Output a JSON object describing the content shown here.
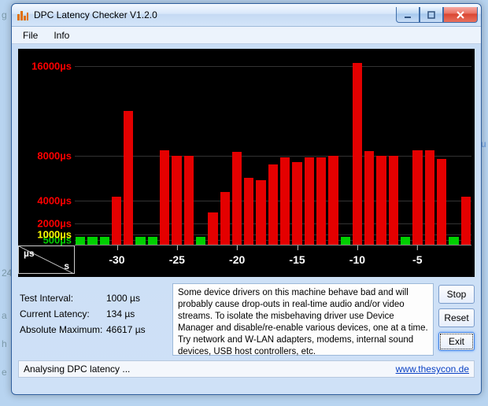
{
  "window": {
    "title": "DPC Latency Checker V1.2.0"
  },
  "menu": {
    "file": "File",
    "info": "Info"
  },
  "chart_data": {
    "type": "bar",
    "title": "",
    "xlabel": "s",
    "ylabel": "µs",
    "ylim": [
      0,
      17000
    ],
    "y_ticks": [
      {
        "v": 500,
        "label": "500µs",
        "color": "#00d000"
      },
      {
        "v": 1000,
        "label": "1000µs",
        "color": "#ffff00"
      },
      {
        "v": 2000,
        "label": "2000µs",
        "color": "#ff0000"
      },
      {
        "v": 4000,
        "label": "4000µs",
        "color": "#ff0000"
      },
      {
        "v": 8000,
        "label": "8000µs",
        "color": "#ff0000"
      },
      {
        "v": 16000,
        "label": "16000µs",
        "color": "#ff0000"
      }
    ],
    "x_ticks": [
      -30,
      -25,
      -20,
      -15,
      -10,
      -5
    ],
    "categories": [
      -33,
      -32,
      -31,
      -30,
      -29,
      -28,
      -27,
      -26,
      -25,
      -24,
      -23,
      -22,
      -21,
      -20,
      -19,
      -18,
      -17,
      -16,
      -15,
      -14,
      -13,
      -12,
      -11,
      -10,
      -9,
      -8,
      -7,
      -6,
      -5,
      -4,
      -3,
      -2,
      -1
    ],
    "series": [
      {
        "name": "green",
        "color": "#00d000",
        "values": [
          700,
          700,
          700,
          4300,
          12000,
          700,
          700,
          8500,
          8000,
          8000,
          700,
          2900,
          4700,
          8300,
          6000,
          5800,
          7200,
          7800,
          7400,
          7800,
          7800,
          8000,
          700,
          16300,
          8400,
          8000,
          8000,
          700,
          8500,
          8500,
          7700,
          700,
          4300
        ]
      },
      {
        "name": "red",
        "color": "#e40000",
        "values": [
          0,
          0,
          0,
          4300,
          12000,
          0,
          0,
          8500,
          8000,
          8000,
          0,
          2900,
          4700,
          8300,
          6000,
          5800,
          7200,
          7800,
          7400,
          7800,
          7800,
          8000,
          0,
          16300,
          8400,
          8000,
          8000,
          0,
          8500,
          8500,
          7700,
          0,
          4300
        ]
      }
    ]
  },
  "stats": {
    "test_interval_label": "Test Interval:",
    "test_interval_value": "1000 µs",
    "current_latency_label": "Current Latency:",
    "current_latency_value": "134 µs",
    "absolute_max_label": "Absolute Maximum:",
    "absolute_max_value": "46617 µs"
  },
  "message": "Some device drivers on this machine behave bad and will probably cause drop-outs in real-time audio and/or video streams. To isolate the misbehaving driver use Device Manager and disable/re-enable various devices, one at a time. Try network and W-LAN adapters, modems, internal sound devices, USB host controllers, etc.",
  "buttons": {
    "stop": "Stop",
    "reset": "Reset",
    "exit": "Exit"
  },
  "status": {
    "text": "Analysing DPC latency ...",
    "link": "www.thesycon.de"
  }
}
